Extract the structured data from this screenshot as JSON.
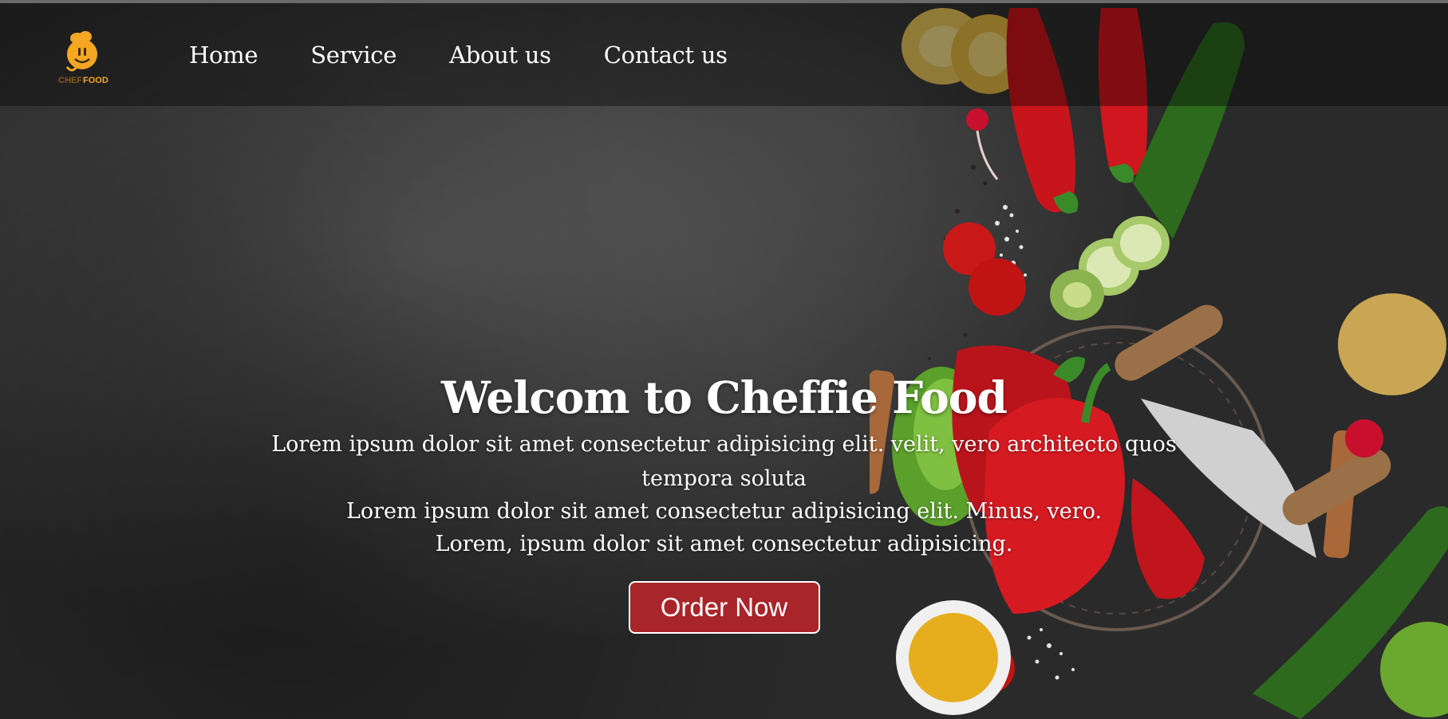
{
  "brand": {
    "logo_text_left": "CHEF",
    "logo_text_right": "FOOD"
  },
  "nav": {
    "items": [
      {
        "label": "Home"
      },
      {
        "label": "Service"
      },
      {
        "label": "About us"
      },
      {
        "label": "Contact us"
      }
    ]
  },
  "hero": {
    "title": "Welcom to Cheffie Food",
    "lines": [
      "Lorem ipsum dolor sit amet consectetur adipisicing elit. velit, vero architecto quos tempora soluta",
      "Lorem ipsum dolor sit amet consectetur adipisicing elit. Minus, vero.",
      "Lorem, ipsum dolor sit amet consectetur adipisicing."
    ],
    "cta_label": "Order Now"
  },
  "colors": {
    "button_bg": "#a8252a",
    "navbar_overlay": "rgba(0,0,0,0.38)",
    "logo_orange": "#f5a623",
    "text": "#ffffff"
  }
}
